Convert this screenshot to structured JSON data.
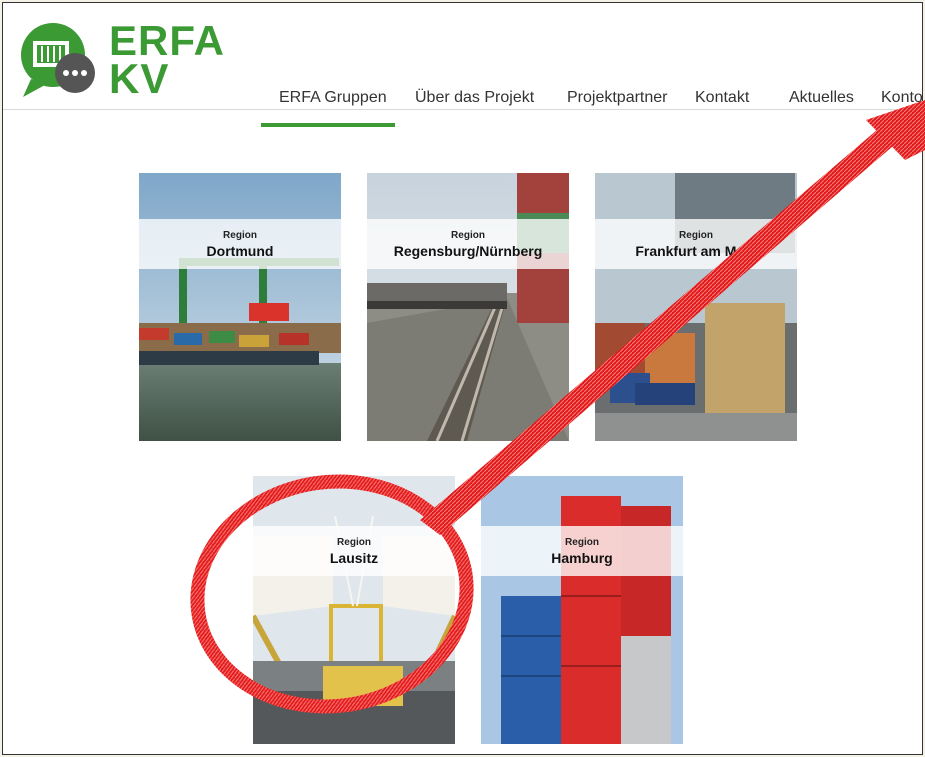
{
  "logo": {
    "line1": "ERFA",
    "line2": "KV"
  },
  "nav": [
    {
      "label": "ERFA Gruppen",
      "active": true
    },
    {
      "label": "Über das Projekt"
    },
    {
      "label": "Projektpartner"
    },
    {
      "label": "Kontakt"
    },
    {
      "label": "Aktuelles"
    },
    {
      "label": "Konto"
    }
  ],
  "tiles": [
    {
      "prefix": "Region",
      "name": "Dortmund"
    },
    {
      "prefix": "Region",
      "name": "Regensburg/Nürnberg"
    },
    {
      "prefix": "Region",
      "name": "Frankfurt am Main"
    },
    {
      "prefix": "Region",
      "name": "Lausitz"
    },
    {
      "prefix": "Region",
      "name": "Hamburg"
    }
  ],
  "colors": {
    "brand": "#3c9a35",
    "annotation": "#e01b1b"
  }
}
